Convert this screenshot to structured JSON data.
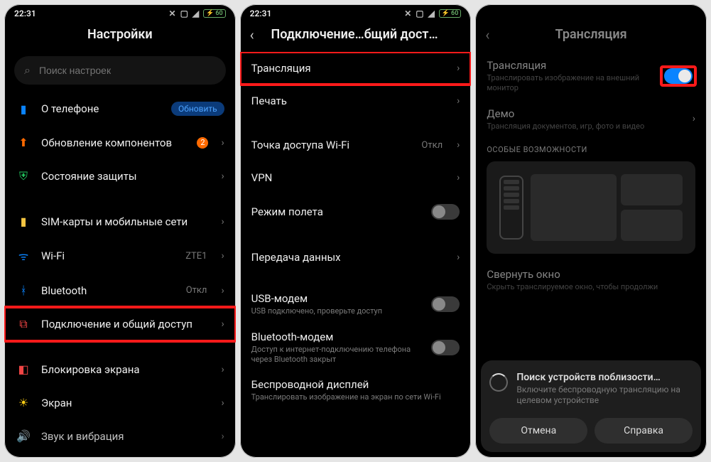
{
  "status": {
    "time": "22:31",
    "battery": "60"
  },
  "screen1": {
    "title": "Настройки",
    "search_placeholder": "Поиск настроек",
    "items": {
      "about": {
        "label": "О телефоне",
        "pill": "Обновить"
      },
      "updates": {
        "label": "Обновление компонентов",
        "badge": "2"
      },
      "security": {
        "label": "Состояние защиты"
      },
      "sim": {
        "label": "SIM-карты и мобильные сети"
      },
      "wifi": {
        "label": "Wi-Fi",
        "value": "ZTE1"
      },
      "bt": {
        "label": "Bluetooth",
        "value": "Откл"
      },
      "share": {
        "label": "Подключение и общий доступ"
      },
      "lock": {
        "label": "Блокировка экрана"
      },
      "display": {
        "label": "Экран"
      },
      "sound": {
        "label": "Звук и вибрация"
      }
    }
  },
  "screen2": {
    "title": "Подключение…бщий доступ",
    "items": {
      "cast": {
        "label": "Трансляция"
      },
      "print": {
        "label": "Печать"
      },
      "hotspot": {
        "label": "Точка доступа Wi-Fi",
        "value": "Откл"
      },
      "vpn": {
        "label": "VPN"
      },
      "airplane": {
        "label": "Режим полета"
      },
      "data": {
        "label": "Передача данных"
      },
      "usb": {
        "label": "USB-модем",
        "sub": "USB подключено, проверьте доступ"
      },
      "btm": {
        "label": "Bluetooth-модем",
        "sub": "Доступ к интернет-подключению телефона через Bluetooth закрыт"
      },
      "wdisp": {
        "label": "Беспроводной дисплей",
        "sub": "Транслировать изображение на экран по сети Wi-Fi"
      }
    }
  },
  "screen3": {
    "title": "Трансляция",
    "cast": {
      "label": "Трансляция",
      "sub": "Транслировать изображение на внешний монитор"
    },
    "demo": {
      "label": "Демо",
      "sub": "Трансляция документов, игр, фото и видео"
    },
    "section": "ОСОБЫЕ ВОЗМОЖНОСТИ",
    "collapse": {
      "label": "Свернуть окно",
      "sub": "Скрыть транслируемое окно, чтобы продолжи"
    },
    "sheet": {
      "title": "Поиск устройств поблизости…",
      "sub": "Включите беспроводную трансляцию на целевом устройстве",
      "cancel": "Отмена",
      "help": "Справка"
    }
  }
}
